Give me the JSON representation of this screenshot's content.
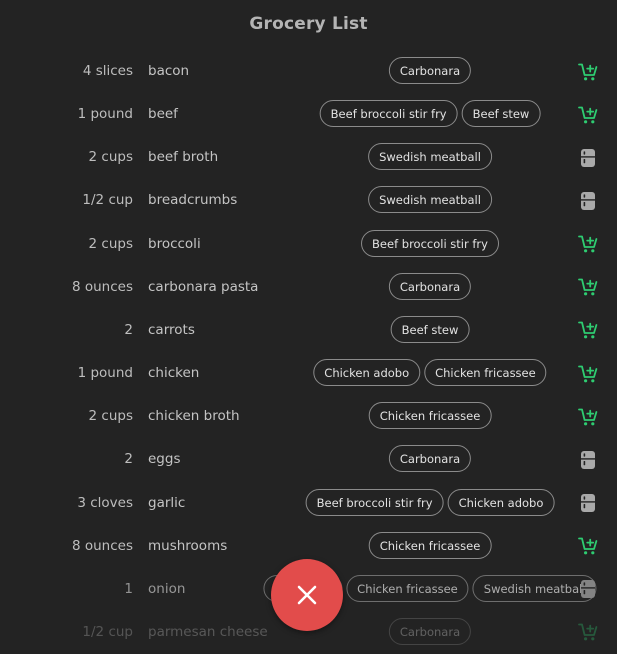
{
  "page": {
    "title": "Grocery List"
  },
  "colors": {
    "cart": "#2ecc71",
    "pantry": "#a9a9a9",
    "fab": "#e24c4b"
  },
  "items": [
    {
      "qty": "4 slices",
      "name": "bacon",
      "recipes": [
        "Carbonara"
      ],
      "status": "cart-icon"
    },
    {
      "qty": "1 pound",
      "name": "beef",
      "recipes": [
        "Beef broccoli stir fry",
        "Beef stew"
      ],
      "status": "cart-icon"
    },
    {
      "qty": "2 cups",
      "name": "beef broth",
      "recipes": [
        "Swedish meatball"
      ],
      "status": "pantry-icon"
    },
    {
      "qty": "1/2 cup",
      "name": "breadcrumbs",
      "recipes": [
        "Swedish meatball"
      ],
      "status": "pantry-icon"
    },
    {
      "qty": "2 cups",
      "name": "broccoli",
      "recipes": [
        "Beef broccoli stir fry"
      ],
      "status": "cart-icon"
    },
    {
      "qty": "8 ounces",
      "name": "carbonara pasta",
      "recipes": [
        "Carbonara"
      ],
      "status": "cart-icon"
    },
    {
      "qty": "2",
      "name": "carrots",
      "recipes": [
        "Beef stew"
      ],
      "status": "cart-icon"
    },
    {
      "qty": "1 pound",
      "name": "chicken",
      "recipes": [
        "Chicken adobo",
        "Chicken fricassee"
      ],
      "status": "cart-icon"
    },
    {
      "qty": "2 cups",
      "name": "chicken broth",
      "recipes": [
        "Chicken fricassee"
      ],
      "status": "cart-icon"
    },
    {
      "qty": "2",
      "name": "eggs",
      "recipes": [
        "Carbonara"
      ],
      "status": "pantry-icon"
    },
    {
      "qty": "3 cloves",
      "name": "garlic",
      "recipes": [
        "Beef broccoli stir fry",
        "Chicken adobo"
      ],
      "status": "pantry-icon"
    },
    {
      "qty": "8 ounces",
      "name": "mushrooms",
      "recipes": [
        "Chicken fricassee"
      ],
      "status": "cart-icon"
    },
    {
      "qty": "1",
      "name": "onion",
      "recipes": [
        "Beef stew",
        "Chicken fricassee",
        "Swedish meatball"
      ],
      "status": "pantry-icon"
    },
    {
      "qty": "1/2 cup",
      "name": "parmesan cheese",
      "recipes": [
        "Carbonara"
      ],
      "status": "cart-icon"
    }
  ],
  "fab": {
    "icon": "close-icon"
  }
}
